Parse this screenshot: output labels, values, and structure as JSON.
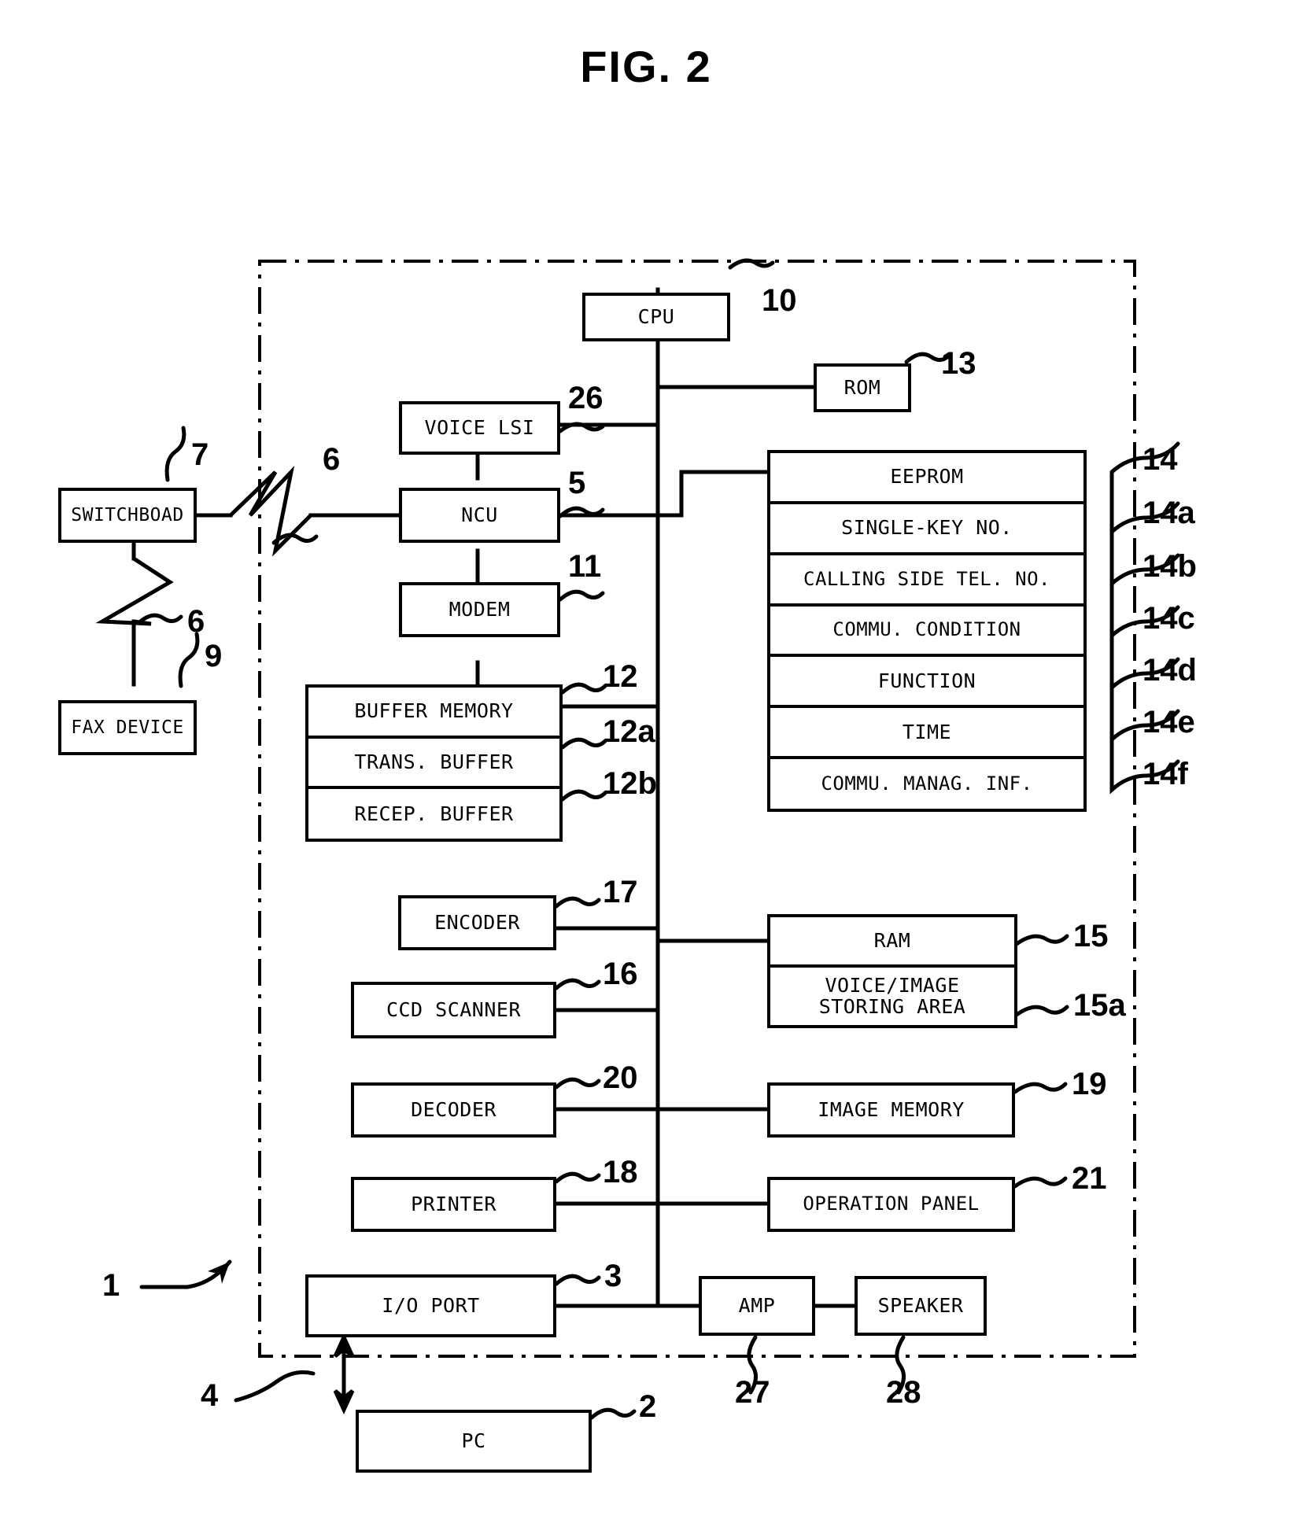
{
  "figure": {
    "title": "FIG. 2"
  },
  "blocks": {
    "cpu": {
      "label": "CPU",
      "ref": "10"
    },
    "rom": {
      "label": "ROM",
      "ref": "13"
    },
    "voice_lsi": {
      "label": "VOICE LSI",
      "ref": "26"
    },
    "ncu": {
      "label": "NCU",
      "ref": "5"
    },
    "modem": {
      "label": "MODEM",
      "ref": "11"
    },
    "switchboard": {
      "label": "SWITCHBOAD",
      "ref": "7"
    },
    "fax_device": {
      "label": "FAX DEVICE",
      "ref": "9"
    },
    "encoder": {
      "label": "ENCODER",
      "ref": "17"
    },
    "ccd_scanner": {
      "label": "CCD SCANNER",
      "ref": "16"
    },
    "decoder": {
      "label": "DECODER",
      "ref": "20"
    },
    "printer": {
      "label": "PRINTER",
      "ref": "18"
    },
    "io_port": {
      "label": "I/O PORT",
      "ref": "3"
    },
    "image_memory": {
      "label": "IMAGE MEMORY",
      "ref": "19"
    },
    "operation_panel": {
      "label": "OPERATION PANEL",
      "ref": "21"
    },
    "amp": {
      "label": "AMP",
      "ref": "27"
    },
    "speaker": {
      "label": "SPEAKER",
      "ref": "28"
    },
    "pc": {
      "label": "PC",
      "ref": "2"
    }
  },
  "buffer_memory": {
    "ref": "12",
    "cells": [
      {
        "label": "BUFFER MEMORY",
        "ref": "12"
      },
      {
        "label": "TRANS. BUFFER",
        "ref": "12a"
      },
      {
        "label": "RECEP. BUFFER",
        "ref": "12b"
      }
    ]
  },
  "eeprom": {
    "ref": "14",
    "cells": [
      {
        "label": "EEPROM",
        "ref": "14"
      },
      {
        "label": "SINGLE-KEY NO.",
        "ref": "14a"
      },
      {
        "label": "CALLING SIDE TEL. NO.",
        "ref": "14b"
      },
      {
        "label": "COMMU. CONDITION",
        "ref": "14c"
      },
      {
        "label": "FUNCTION",
        "ref": "14d"
      },
      {
        "label": "TIME",
        "ref": "14e"
      },
      {
        "label": "COMMU. MANAG. INF.",
        "ref": "14f"
      }
    ]
  },
  "ram": {
    "ref": "15",
    "cells": [
      {
        "label": "RAM",
        "ref": "15"
      },
      {
        "label": "VOICE/IMAGE\nSTORING AREA",
        "ref": "15a"
      }
    ]
  },
  "line_refs": {
    "device_enclosure": "1",
    "line_6_upper": "6",
    "line_6_lower": "6",
    "io_link_4": "4"
  }
}
